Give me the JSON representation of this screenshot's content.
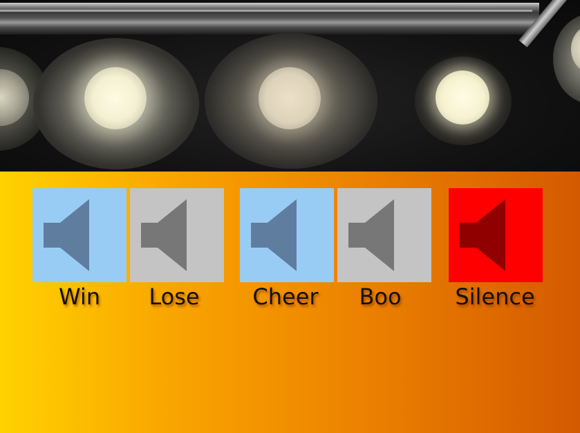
{
  "colors": {
    "panel_gradient_start": "#ffd200",
    "panel_gradient_end": "#d45a00",
    "tile_blue": "#99ccf5",
    "tile_gray": "#c4c4c4",
    "tile_red": "#ff0000",
    "speaker_blue": "#5f7d9e",
    "speaker_gray": "#777777",
    "speaker_red": "#900000",
    "label_text": "#111111"
  },
  "sound_buttons": [
    {
      "label": "Win",
      "icon": "speaker-icon",
      "tile_color": "#99ccf5",
      "icon_color": "#5f7d9e"
    },
    {
      "label": "Lose",
      "icon": "speaker-icon",
      "tile_color": "#c4c4c4",
      "icon_color": "#777777"
    },
    {
      "label": "Cheer",
      "icon": "speaker-icon",
      "tile_color": "#99ccf5",
      "icon_color": "#5f7d9e"
    },
    {
      "label": "Boo",
      "icon": "speaker-icon",
      "tile_color": "#c4c4c4",
      "icon_color": "#777777"
    },
    {
      "label": "Silence",
      "icon": "speaker-icon",
      "tile_color": "#ff0000",
      "icon_color": "#900000"
    }
  ]
}
